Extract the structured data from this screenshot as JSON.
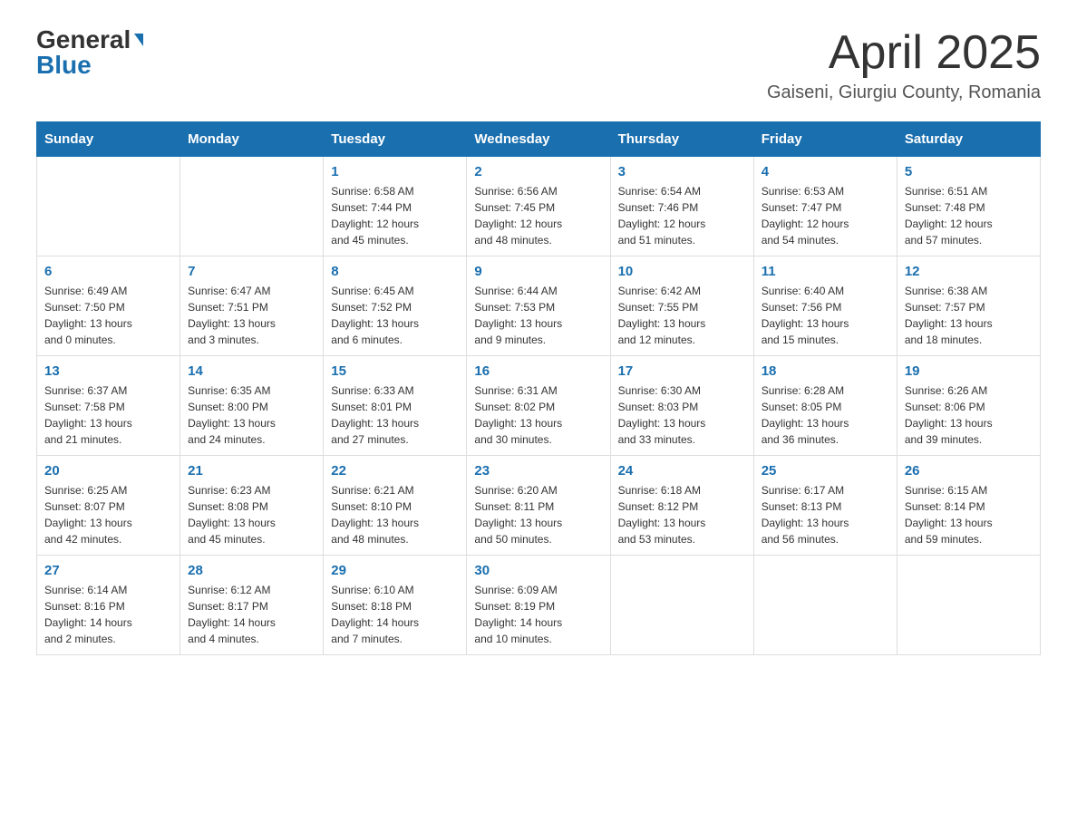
{
  "header": {
    "logo_general": "General",
    "logo_blue": "Blue",
    "month_title": "April 2025",
    "location": "Gaiseni, Giurgiu County, Romania"
  },
  "days_of_week": [
    "Sunday",
    "Monday",
    "Tuesday",
    "Wednesday",
    "Thursday",
    "Friday",
    "Saturday"
  ],
  "weeks": [
    [
      {
        "day": "",
        "info": ""
      },
      {
        "day": "",
        "info": ""
      },
      {
        "day": "1",
        "info": "Sunrise: 6:58 AM\nSunset: 7:44 PM\nDaylight: 12 hours\nand 45 minutes."
      },
      {
        "day": "2",
        "info": "Sunrise: 6:56 AM\nSunset: 7:45 PM\nDaylight: 12 hours\nand 48 minutes."
      },
      {
        "day": "3",
        "info": "Sunrise: 6:54 AM\nSunset: 7:46 PM\nDaylight: 12 hours\nand 51 minutes."
      },
      {
        "day": "4",
        "info": "Sunrise: 6:53 AM\nSunset: 7:47 PM\nDaylight: 12 hours\nand 54 minutes."
      },
      {
        "day": "5",
        "info": "Sunrise: 6:51 AM\nSunset: 7:48 PM\nDaylight: 12 hours\nand 57 minutes."
      }
    ],
    [
      {
        "day": "6",
        "info": "Sunrise: 6:49 AM\nSunset: 7:50 PM\nDaylight: 13 hours\nand 0 minutes."
      },
      {
        "day": "7",
        "info": "Sunrise: 6:47 AM\nSunset: 7:51 PM\nDaylight: 13 hours\nand 3 minutes."
      },
      {
        "day": "8",
        "info": "Sunrise: 6:45 AM\nSunset: 7:52 PM\nDaylight: 13 hours\nand 6 minutes."
      },
      {
        "day": "9",
        "info": "Sunrise: 6:44 AM\nSunset: 7:53 PM\nDaylight: 13 hours\nand 9 minutes."
      },
      {
        "day": "10",
        "info": "Sunrise: 6:42 AM\nSunset: 7:55 PM\nDaylight: 13 hours\nand 12 minutes."
      },
      {
        "day": "11",
        "info": "Sunrise: 6:40 AM\nSunset: 7:56 PM\nDaylight: 13 hours\nand 15 minutes."
      },
      {
        "day": "12",
        "info": "Sunrise: 6:38 AM\nSunset: 7:57 PM\nDaylight: 13 hours\nand 18 minutes."
      }
    ],
    [
      {
        "day": "13",
        "info": "Sunrise: 6:37 AM\nSunset: 7:58 PM\nDaylight: 13 hours\nand 21 minutes."
      },
      {
        "day": "14",
        "info": "Sunrise: 6:35 AM\nSunset: 8:00 PM\nDaylight: 13 hours\nand 24 minutes."
      },
      {
        "day": "15",
        "info": "Sunrise: 6:33 AM\nSunset: 8:01 PM\nDaylight: 13 hours\nand 27 minutes."
      },
      {
        "day": "16",
        "info": "Sunrise: 6:31 AM\nSunset: 8:02 PM\nDaylight: 13 hours\nand 30 minutes."
      },
      {
        "day": "17",
        "info": "Sunrise: 6:30 AM\nSunset: 8:03 PM\nDaylight: 13 hours\nand 33 minutes."
      },
      {
        "day": "18",
        "info": "Sunrise: 6:28 AM\nSunset: 8:05 PM\nDaylight: 13 hours\nand 36 minutes."
      },
      {
        "day": "19",
        "info": "Sunrise: 6:26 AM\nSunset: 8:06 PM\nDaylight: 13 hours\nand 39 minutes."
      }
    ],
    [
      {
        "day": "20",
        "info": "Sunrise: 6:25 AM\nSunset: 8:07 PM\nDaylight: 13 hours\nand 42 minutes."
      },
      {
        "day": "21",
        "info": "Sunrise: 6:23 AM\nSunset: 8:08 PM\nDaylight: 13 hours\nand 45 minutes."
      },
      {
        "day": "22",
        "info": "Sunrise: 6:21 AM\nSunset: 8:10 PM\nDaylight: 13 hours\nand 48 minutes."
      },
      {
        "day": "23",
        "info": "Sunrise: 6:20 AM\nSunset: 8:11 PM\nDaylight: 13 hours\nand 50 minutes."
      },
      {
        "day": "24",
        "info": "Sunrise: 6:18 AM\nSunset: 8:12 PM\nDaylight: 13 hours\nand 53 minutes."
      },
      {
        "day": "25",
        "info": "Sunrise: 6:17 AM\nSunset: 8:13 PM\nDaylight: 13 hours\nand 56 minutes."
      },
      {
        "day": "26",
        "info": "Sunrise: 6:15 AM\nSunset: 8:14 PM\nDaylight: 13 hours\nand 59 minutes."
      }
    ],
    [
      {
        "day": "27",
        "info": "Sunrise: 6:14 AM\nSunset: 8:16 PM\nDaylight: 14 hours\nand 2 minutes."
      },
      {
        "day": "28",
        "info": "Sunrise: 6:12 AM\nSunset: 8:17 PM\nDaylight: 14 hours\nand 4 minutes."
      },
      {
        "day": "29",
        "info": "Sunrise: 6:10 AM\nSunset: 8:18 PM\nDaylight: 14 hours\nand 7 minutes."
      },
      {
        "day": "30",
        "info": "Sunrise: 6:09 AM\nSunset: 8:19 PM\nDaylight: 14 hours\nand 10 minutes."
      },
      {
        "day": "",
        "info": ""
      },
      {
        "day": "",
        "info": ""
      },
      {
        "day": "",
        "info": ""
      }
    ]
  ]
}
